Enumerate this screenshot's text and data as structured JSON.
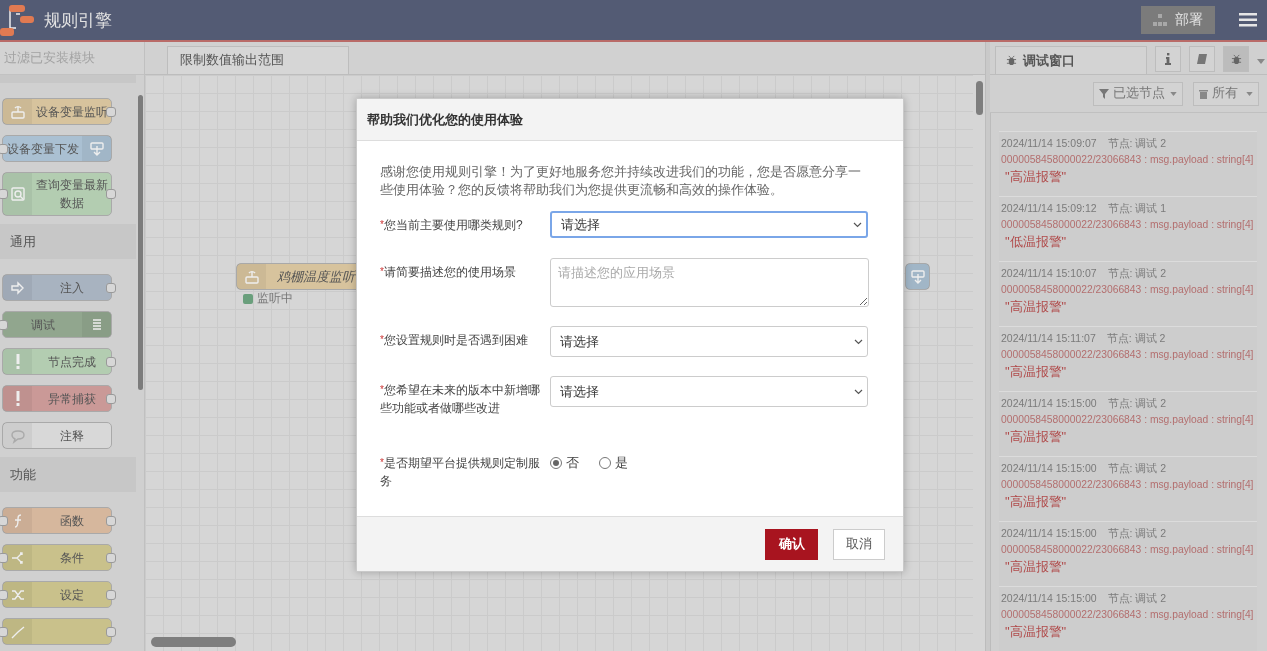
{
  "header": {
    "title": "规则引擎",
    "deploy_button": {
      "label": "部署",
      "disabled": true
    }
  },
  "palette": {
    "filter": {
      "placeholder": "过滤已安装模块"
    },
    "categories": [
      {
        "nodes": [
          {
            "label": "设备变量监听",
            "kind": "monitor",
            "color": "#d7c39d",
            "input": false,
            "output": true
          },
          {
            "label": "设备变量下发",
            "kind": "download",
            "color": "#aac0d2",
            "input": true,
            "output": false
          },
          {
            "label": "查询变量最新数据",
            "kind": "query",
            "color": "#b3cdb1",
            "input": true,
            "output": true
          }
        ]
      },
      {
        "title": "通用",
        "nodes": [
          {
            "label": "注入",
            "kind": "inject",
            "color": "#a8b3c0",
            "input": false,
            "output": true
          },
          {
            "label": "调试",
            "kind": "debug",
            "color": "#91a68e",
            "input": true,
            "output": false
          },
          {
            "label": "节点完成",
            "kind": "complete",
            "color": "#b3cdb1",
            "input": false,
            "output": true
          },
          {
            "label": "异常捕获",
            "kind": "catch",
            "color": "#ca9997",
            "input": false,
            "output": true
          },
          {
            "label": "注释",
            "kind": "comment",
            "color": "#d8d8d8",
            "input": false,
            "output": false
          }
        ]
      },
      {
        "title": "功能",
        "nodes": [
          {
            "label": "函数",
            "kind": "function",
            "color": "#d6b79d",
            "input": true,
            "output": true
          },
          {
            "label": "条件",
            "kind": "switch",
            "color": "#c9c18b",
            "input": true,
            "output": true
          },
          {
            "label": "设定",
            "kind": "change",
            "color": "#c9c18b",
            "input": true,
            "output": true
          },
          {
            "kind": "map",
            "color": "#c9c18b",
            "input": true,
            "output": true
          }
        ]
      }
    ]
  },
  "workspace": {
    "tabs": [
      {
        "label": "限制数值输出范围",
        "selected": true
      }
    ],
    "nodes": [
      {
        "label": "鸡棚温度监听",
        "kind": "monitor",
        "color": "#d7c39d",
        "status": {
          "text": "监听中",
          "color": "#6a9f7c"
        }
      },
      {
        "kind": "download",
        "color": "#aac0d2"
      }
    ]
  },
  "sidebar": {
    "tabs": [
      {
        "label": "调试窗口",
        "selected": true
      }
    ],
    "tool_buttons": [
      {
        "kind": "info",
        "selected": false
      },
      {
        "kind": "book",
        "selected": false
      },
      {
        "kind": "bug",
        "selected": true
      }
    ],
    "filter": {
      "label": "已选节点"
    },
    "clear": {
      "label": "所有"
    },
    "messages": [
      {
        "time": "2024/11/14 15:09:07",
        "node": "节点: 调试 2",
        "topic": "0000058458000022/23066843 : msg.payload : string[4]",
        "value": "\"高温报警\""
      },
      {
        "time": "2024/11/14 15:09:12",
        "node": "节点: 调试 1",
        "topic": "0000058458000022/23066843 : msg.payload : string[4]",
        "value": "\"低温报警\""
      },
      {
        "time": "2024/11/14 15:10:07",
        "node": "节点: 调试 2",
        "topic": "0000058458000022/23066843 : msg.payload : string[4]",
        "value": "\"高温报警\""
      },
      {
        "time": "2024/11/14 15:11:07",
        "node": "节点: 调试 2",
        "topic": "0000058458000022/23066843 : msg.payload : string[4]",
        "value": "\"高温报警\""
      },
      {
        "time": "2024/11/14 15:15:00",
        "node": "节点: 调试 2",
        "topic": "0000058458000022/23066843 : msg.payload : string[4]",
        "value": "\"高温报警\""
      },
      {
        "time": "2024/11/14 15:15:00",
        "node": "节点: 调试 2",
        "topic": "0000058458000022/23066843 : msg.payload : string[4]",
        "value": "\"高温报警\""
      },
      {
        "time": "2024/11/14 15:15:00",
        "node": "节点: 调试 2",
        "topic": "0000058458000022/23066843 : msg.payload : string[4]",
        "value": "\"高温报警\""
      },
      {
        "time": "2024/11/14 15:15:00",
        "node": "节点: 调试 2",
        "topic": "0000058458000022/23066843 : msg.payload : string[4]",
        "value": "\"高温报警\""
      }
    ]
  },
  "dialog": {
    "title": "帮助我们优化您的使用体验",
    "intro": "感谢您使用规则引擎！为了更好地服务您并持续改进我们的功能，您是否愿意分享一些使用体验？您的反馈将帮助我们为您提供更流畅和高效的操作体验。",
    "fields": [
      {
        "kind": "select",
        "mark": "*",
        "label": "您当前主要使用哪类规则?",
        "value": "请选择",
        "focused": true
      },
      {
        "kind": "textarea",
        "mark": "*",
        "label": "请简要描述您的使用场景",
        "placeholder": "请描述您的应用场景",
        "focused": false
      },
      {
        "kind": "select",
        "mark": "*",
        "label": "您设置规则时是否遇到困难",
        "value": "请选择",
        "focused": false
      },
      {
        "kind": "select",
        "mark": "*",
        "label": "您希望在未来的版本中新增哪些功能或者做哪些改进",
        "value": "请选择",
        "focused": false
      },
      {
        "kind": "radio",
        "mark": "*",
        "label": "是否期望平台提供规则定制服务",
        "options": [
          {
            "label": "否",
            "selected": true
          },
          {
            "label": "是",
            "selected": false
          }
        ]
      }
    ],
    "buttons": [
      {
        "label": "确认",
        "kind": "primary"
      },
      {
        "label": "取消",
        "kind": "secondary"
      }
    ]
  }
}
